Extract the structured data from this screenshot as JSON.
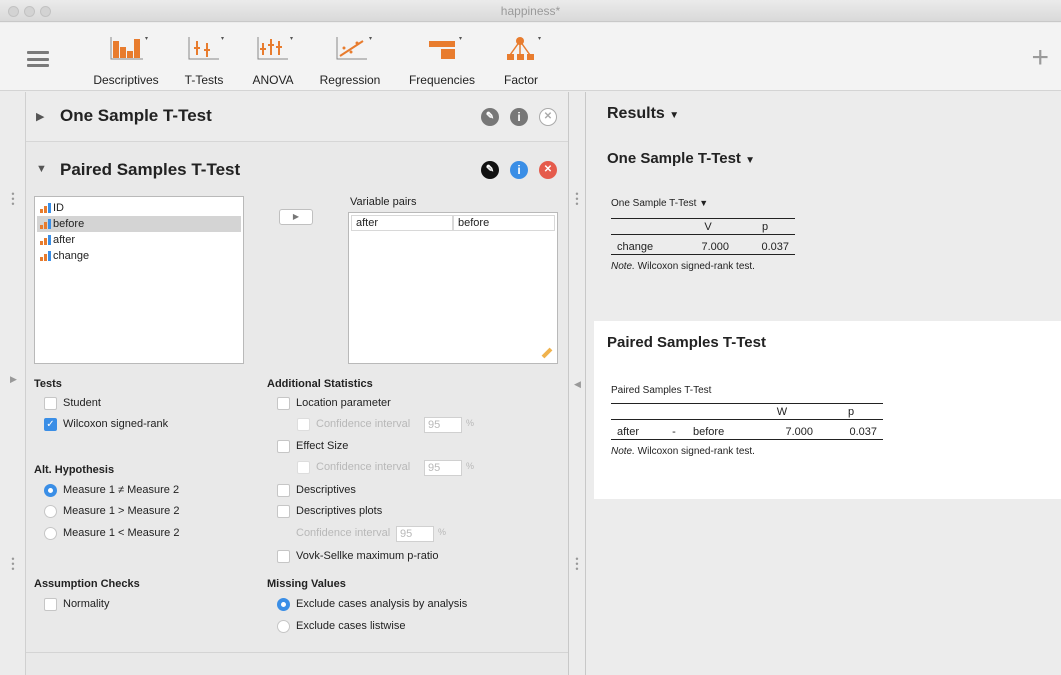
{
  "window": {
    "title": "happiness*"
  },
  "ribbon": {
    "buttons": [
      {
        "label": "Descriptives",
        "icon": "descriptives-icon"
      },
      {
        "label": "T-Tests",
        "icon": "t-tests-icon"
      },
      {
        "label": "ANOVA",
        "icon": "anova-icon"
      },
      {
        "label": "Regression",
        "icon": "regression-icon"
      },
      {
        "label": "Frequencies",
        "icon": "frequencies-icon"
      },
      {
        "label": "Factor",
        "icon": "factor-icon"
      }
    ],
    "plus": "+"
  },
  "analyses": {
    "one_sample": {
      "title": "One Sample T-Test"
    },
    "paired": {
      "title": "Paired Samples T-Test",
      "variables": [
        "ID",
        "before",
        "after",
        "change"
      ],
      "selected_variable": "before",
      "variable_pairs_label": "Variable pairs",
      "pairs": [
        {
          "a": "after",
          "b": "before"
        }
      ],
      "tests": {
        "label": "Tests",
        "student": "Student",
        "wilcoxon": "Wilcoxon signed-rank"
      },
      "alt_hypothesis": {
        "label": "Alt. Hypothesis",
        "opt1": "Measure 1 ≠ Measure 2",
        "opt2": "Measure 1 > Measure 2",
        "opt3": "Measure 1 < Measure 2"
      },
      "assumption_checks": {
        "label": "Assumption Checks",
        "normality": "Normality"
      },
      "additional": {
        "label": "Additional Statistics",
        "location": "Location parameter",
        "ci": "Confidence interval",
        "ci_value": "95",
        "pct": "%",
        "effect_size": "Effect Size",
        "descriptives": "Descriptives",
        "descriptives_plots": "Descriptives plots",
        "vovk": "Vovk-Sellke maximum p-ratio"
      },
      "missing": {
        "label": "Missing Values",
        "opt1": "Exclude cases analysis by analysis",
        "opt2": "Exclude cases listwise"
      }
    }
  },
  "results": {
    "heading": "Results",
    "one_sample": {
      "heading": "One Sample T-Test",
      "table_title": "One Sample T-Test",
      "cols": [
        "V",
        "p"
      ],
      "row": {
        "name": "change",
        "v": "7.000",
        "p": "0.037"
      },
      "note_label": "Note.",
      "note": " Wilcoxon signed-rank test."
    },
    "paired": {
      "heading": "Paired Samples T-Test",
      "table_title": "Paired Samples T-Test",
      "cols": [
        "W",
        "p"
      ],
      "row": {
        "a": "after",
        "dash": "-",
        "b": "before",
        "w": "7.000",
        "p": "0.037"
      },
      "note_label": "Note.",
      "note": " Wilcoxon signed-rank test."
    }
  },
  "colors": {
    "accent": "#3a8ee6",
    "close": "#e55b4c",
    "ribbon_orange": "#e87c2e"
  }
}
